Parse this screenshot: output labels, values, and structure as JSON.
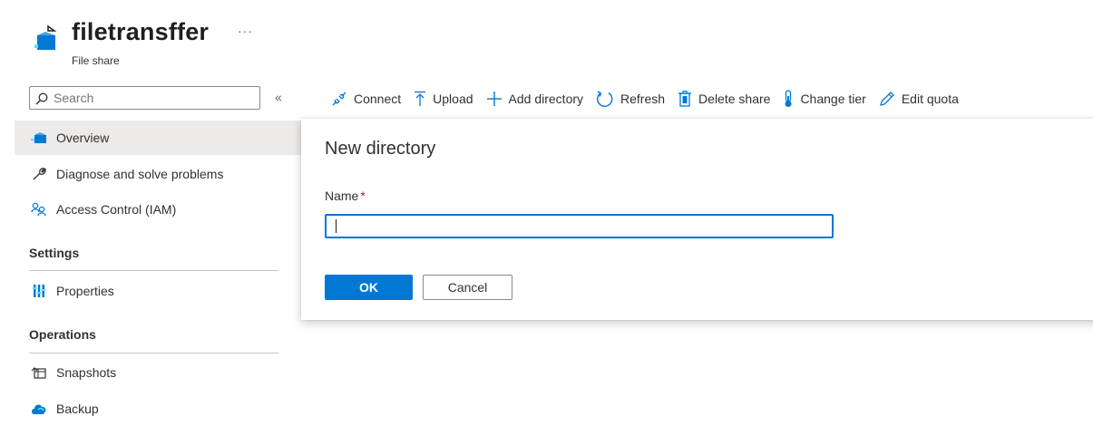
{
  "header": {
    "title": "filetransffer",
    "subtitle": "File share",
    "more": "···",
    "icon": "file-share-icon"
  },
  "search": {
    "placeholder": "Search",
    "collapse": "«"
  },
  "sidebar": {
    "items": [
      {
        "label": "Overview",
        "icon": "file-share-icon",
        "active": true
      },
      {
        "label": "Diagnose and solve problems",
        "icon": "wrench-icon"
      },
      {
        "label": "Access Control (IAM)",
        "icon": "people-icon"
      }
    ],
    "sections": [
      {
        "heading": "Settings",
        "items": [
          {
            "label": "Properties",
            "icon": "properties-icon"
          }
        ]
      },
      {
        "heading": "Operations",
        "items": [
          {
            "label": "Snapshots",
            "icon": "snapshot-icon"
          },
          {
            "label": "Backup",
            "icon": "cloud-backup-icon"
          }
        ]
      }
    ]
  },
  "toolbar": {
    "connect": "Connect",
    "upload": "Upload",
    "add_directory": "Add directory",
    "refresh": "Refresh",
    "delete_share": "Delete share",
    "change_tier": "Change tier",
    "edit_quota": "Edit quota"
  },
  "dialog": {
    "title": "New directory",
    "name_label": "Name",
    "required_mark": "*",
    "name_value": "",
    "ok": "OK",
    "cancel": "Cancel"
  },
  "colors": {
    "accent": "#0078d4",
    "required": "#a4262c",
    "active_bg": "#edebe9"
  }
}
